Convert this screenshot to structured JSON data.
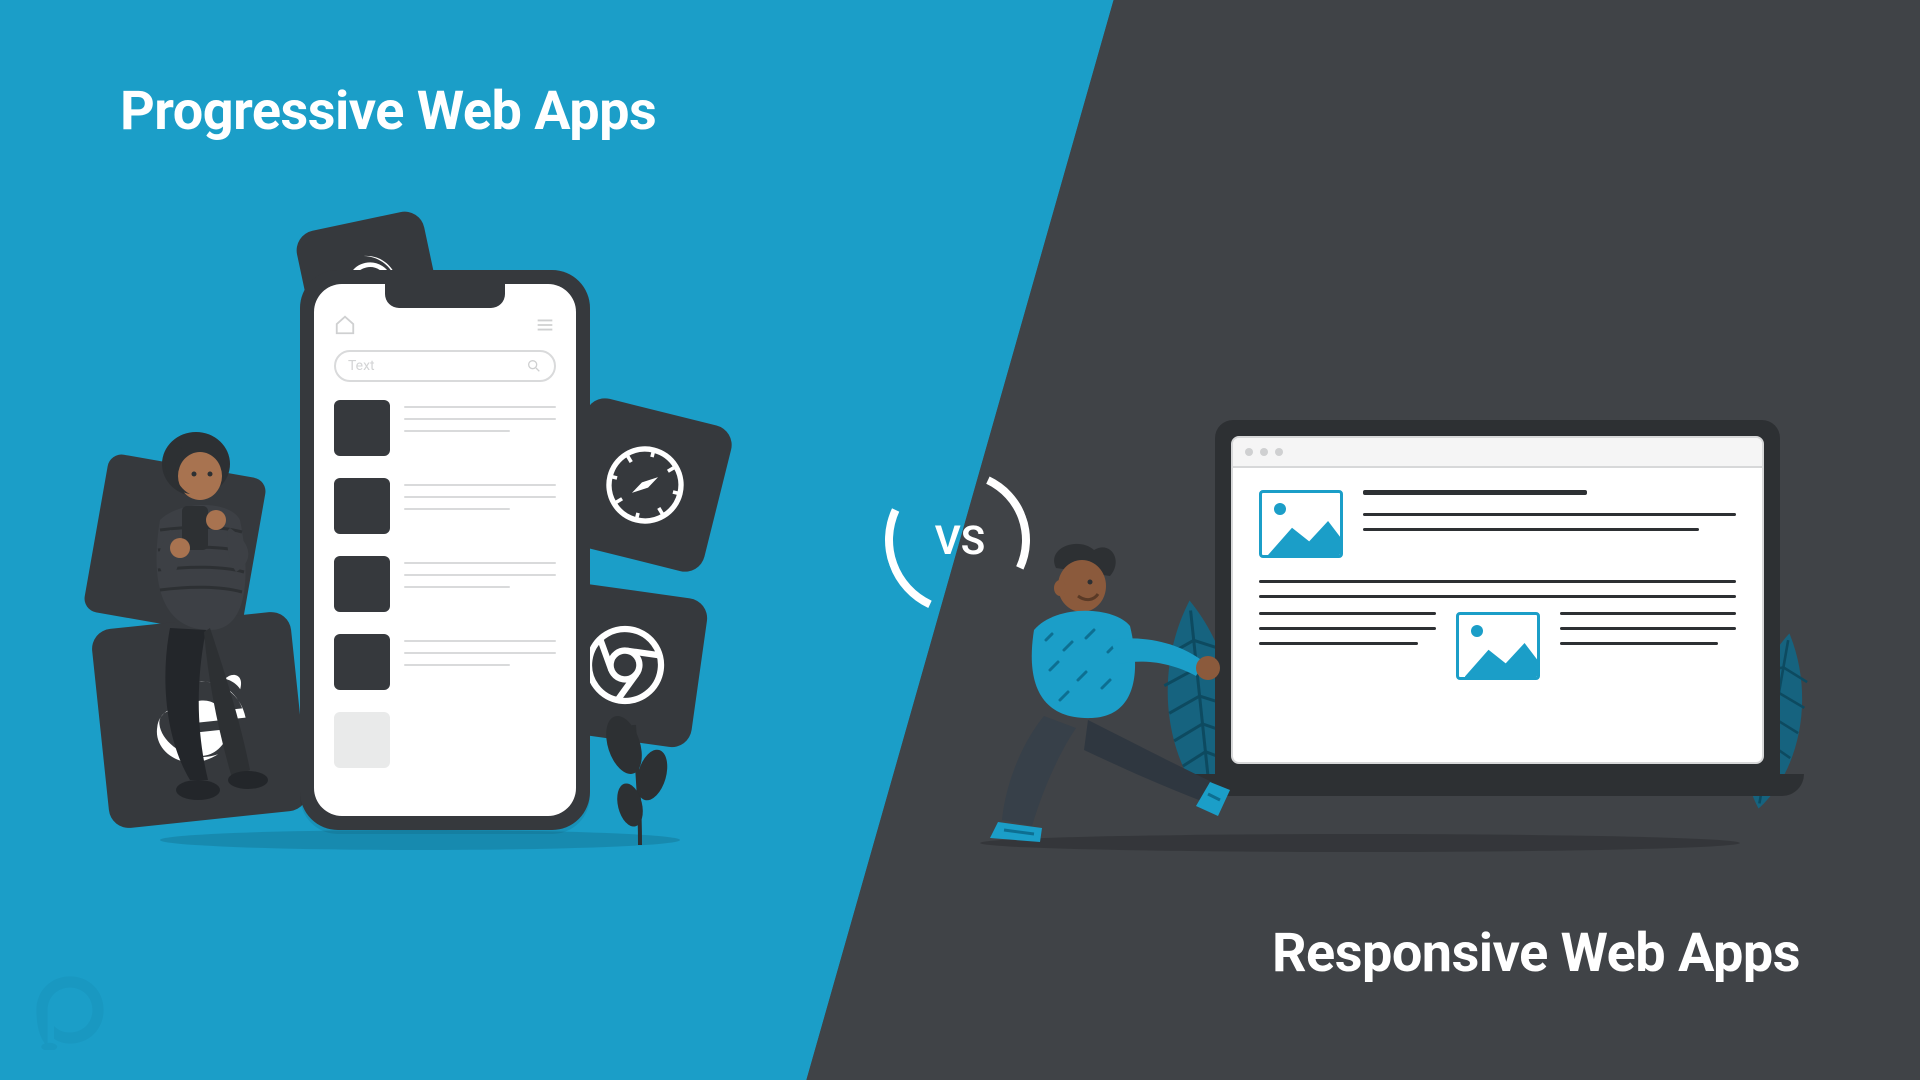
{
  "titles": {
    "left": "Progressive Web Apps",
    "right": "Responsive Web Apps"
  },
  "vs_label": "VS",
  "phone": {
    "search_placeholder": "Text"
  },
  "colors": {
    "left_bg": "#1b9ec8",
    "right_bg": "#404347",
    "accent": "#1b9ec8",
    "tile": "#36393d",
    "white": "#ffffff"
  },
  "icons": {
    "browsers": [
      "firefox-icon",
      "safari-icon",
      "chrome-icon",
      "ie-icon"
    ]
  }
}
